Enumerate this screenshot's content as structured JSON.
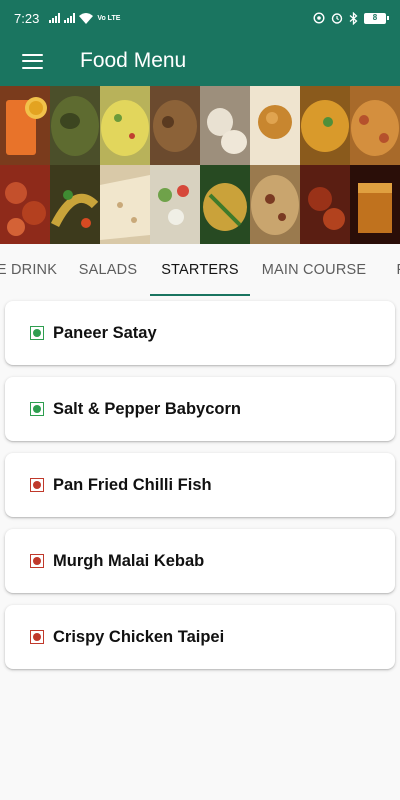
{
  "status_bar": {
    "time": "7:23",
    "volte_label": "Vo LTE",
    "battery_level": "8",
    "icons": [
      "signal-icon",
      "signal-icon",
      "wifi-icon",
      "volte-icon",
      "data-saver-icon",
      "alarm-icon",
      "bluetooth-icon",
      "battery-icon"
    ]
  },
  "app_bar": {
    "menu_icon": "hamburger-menu-icon",
    "title": "Food Menu"
  },
  "header_image": {
    "description_icon": "food-collage-image"
  },
  "tabs": [
    {
      "label": "E DRINK",
      "active": false
    },
    {
      "label": "SALADS",
      "active": false
    },
    {
      "label": "STARTERS",
      "active": true
    },
    {
      "label": "MAIN COURSE",
      "active": false
    },
    {
      "label": "F",
      "active": false
    }
  ],
  "items": [
    {
      "name": "Paneer Satay",
      "diet": "veg"
    },
    {
      "name": "Salt & Pepper Babycorn",
      "diet": "veg"
    },
    {
      "name": "Pan Fried Chilli Fish",
      "diet": "non-veg"
    },
    {
      "name": "Murgh Malai Kebab",
      "diet": "non-veg"
    },
    {
      "name": "Crispy Chicken Taipei",
      "diet": "non-veg"
    }
  ],
  "colors": {
    "primary": "#1a7560",
    "veg": "#2e9e4f",
    "non_veg": "#c0392b"
  }
}
